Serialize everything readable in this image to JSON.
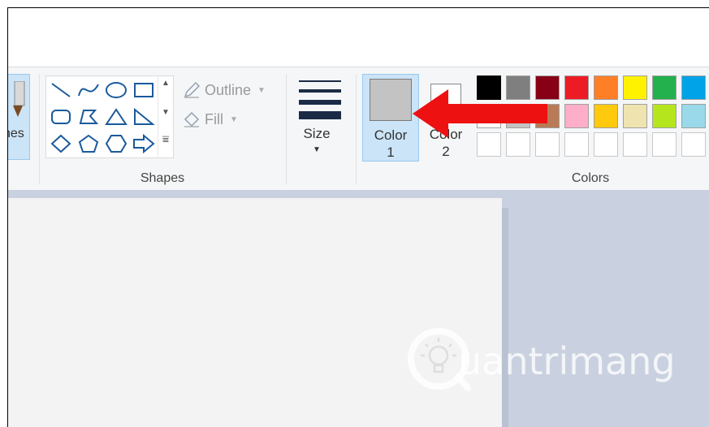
{
  "ribbon": {
    "brushes_label": "hes",
    "shapes": {
      "group_label": "Shapes",
      "outline_label": "Outline",
      "fill_label": "Fill",
      "gallery": [
        "line",
        "curve",
        "oval",
        "rectangle",
        "rounded-rectangle",
        "polygon",
        "triangle",
        "right-triangle",
        "diamond",
        "pentagon",
        "hexagon",
        "right-arrow"
      ]
    },
    "size": {
      "label": "Size"
    },
    "colors": {
      "group_label": "Colors",
      "color1": {
        "label_line1": "Color",
        "label_line2": "1",
        "value": "#c3c3c3"
      },
      "color2": {
        "label_line1": "Color",
        "label_line2": "2",
        "value": "#ffffff"
      },
      "palette_row1": [
        "#000000",
        "#7f7f7f",
        "#880015",
        "#ed1c24",
        "#ff7f27",
        "#fff200",
        "#22b14c",
        "#00a2e8"
      ],
      "palette_row2": [
        "#ffffff",
        "#c3c3c3",
        "#b97a57",
        "#ffaec9",
        "#ffc90e",
        "#efe4b0",
        "#b5e61d",
        "#99d9ea"
      ],
      "palette_row3": [
        "",
        "",
        "",
        "",
        "",
        "",
        "",
        ""
      ]
    }
  },
  "watermark": {
    "text": "uantrimang"
  },
  "annotation": {
    "color": "#ee1111"
  }
}
